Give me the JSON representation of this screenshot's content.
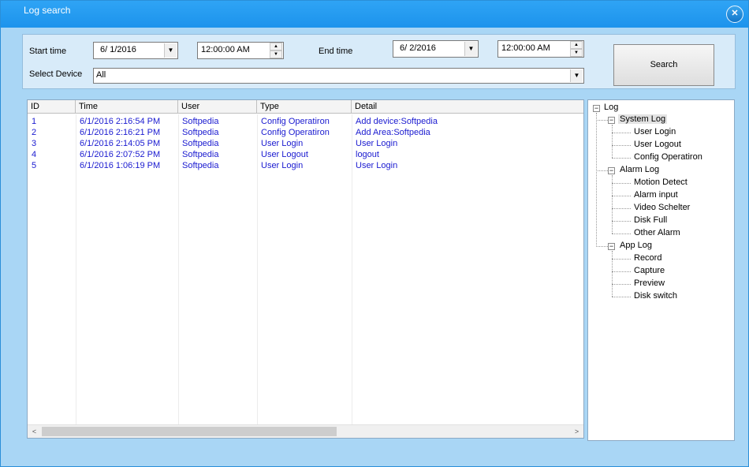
{
  "window": {
    "title": "Log search",
    "close_symbol": "✕"
  },
  "filter": {
    "start_time_label": "Start time",
    "start_date": "6/  1/2016",
    "start_time": "12:00:00 AM",
    "end_time_label": "End time",
    "end_date": "6/  2/2016",
    "end_time": "12:00:00 AM",
    "device_label": "Select Device",
    "device_value": "All",
    "search_label": "Search"
  },
  "table": {
    "columns": [
      "ID",
      "Time",
      "User",
      "Type",
      "Detail"
    ],
    "rows": [
      [
        "1",
        "6/1/2016 2:16:54 PM",
        "Softpedia",
        "Config Operatiron",
        "Add device:Softpedia"
      ],
      [
        "2",
        "6/1/2016 2:16:21 PM",
        "Softpedia",
        "Config Operatiron",
        "Add Area:Softpedia"
      ],
      [
        "3",
        "6/1/2016 2:14:05 PM",
        "Softpedia",
        "User Login",
        "User Login"
      ],
      [
        "4",
        "6/1/2016 2:07:52 PM",
        "Softpedia",
        "User Logout",
        "logout"
      ],
      [
        "5",
        "6/1/2016 1:06:19 PM",
        "Softpedia",
        "User Login",
        "User Login"
      ]
    ]
  },
  "tree": {
    "root": "Log",
    "groups": [
      {
        "label": "System Log",
        "selected": true,
        "children": [
          "User Login",
          "User Logout",
          "Config Operatiron"
        ]
      },
      {
        "label": "Alarm Log",
        "selected": false,
        "children": [
          "Motion Detect",
          "Alarm input",
          "Video Schelter",
          "Disk Full",
          "Other Alarm"
        ]
      },
      {
        "label": "App Log",
        "selected": false,
        "children": [
          "Record",
          "Capture",
          "Preview",
          "Disk switch"
        ]
      }
    ]
  },
  "colors": {
    "title_bar": "#1c93ec",
    "window_bg": "#a9d6f5",
    "row_text": "#1a1ad0"
  }
}
